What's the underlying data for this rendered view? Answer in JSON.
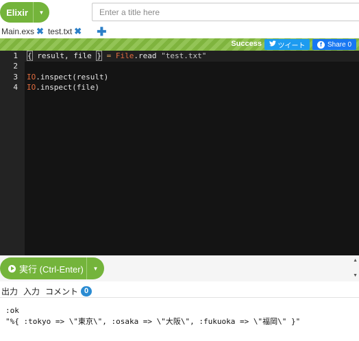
{
  "toolbar": {
    "language": "Elixir",
    "title_placeholder": "Enter a title here"
  },
  "tabs": [
    {
      "label": "Main.exs"
    },
    {
      "label": "test.txt"
    }
  ],
  "status": {
    "text": "Success",
    "tweet_label": "ツイート",
    "share_label": "Share 0"
  },
  "editor": {
    "line_numbers": [
      "1",
      "2",
      "3",
      "4"
    ],
    "lines": [
      "{ result, file } = File.read \"test.txt\"",
      "",
      "IO.inspect(result)",
      "IO.inspect(file)"
    ]
  },
  "run": {
    "label": "実行 (Ctrl-Enter)"
  },
  "output_tabs": {
    "output": "出力",
    "input": "入力",
    "comments": "コメント",
    "comment_count": "0"
  },
  "output": {
    "lines": [
      ":ok",
      "\"%{ :tokyo => \\\"東京\\\", :osaka => \\\"大阪\\\", :fukuoka => \\\"福岡\\\" }\""
    ]
  },
  "colors": {
    "accent_green": "#74b43b",
    "tab_blue": "#2c7fc7",
    "editor_bg": "#141414"
  }
}
